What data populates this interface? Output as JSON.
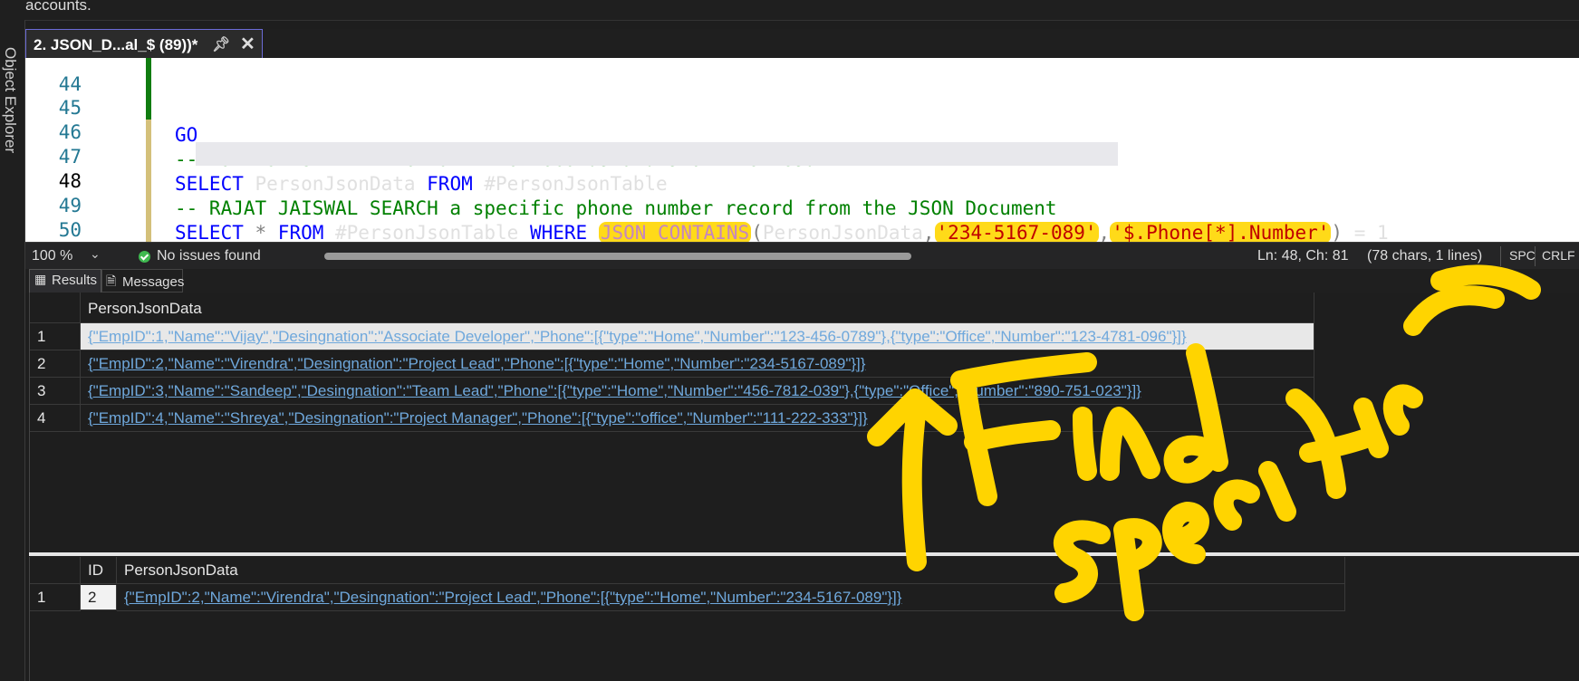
{
  "top_text": "accounts.",
  "side_panel": "Object Explorer",
  "tab": {
    "title": "2. JSON_D...al_$ (89))*",
    "pin_icon": "pin-icon",
    "close_icon": "close-icon"
  },
  "editor": {
    "lines": [
      {
        "num": "44",
        "code": ""
      },
      {
        "num": "45",
        "code": "GO"
      },
      {
        "num": "46",
        "code": "--RAJAT JAISWAL  FETCH all the records and show the result"
      },
      {
        "num": "47",
        "code": "SELECT PersonJsonData FROM #PersonJsonTable"
      },
      {
        "num": "48",
        "code": "-- RAJAT JAISWAL SEARCH a specific phone number record from the JSON Document"
      },
      {
        "num": "49",
        "code": "SELECT * FROM #PersonJsonTable WHERE JSON_CONTAINS(PersonJsonData,'234-5167-089','$.Phone[*].Number') = 1"
      },
      {
        "num": "50",
        "code": ""
      }
    ],
    "current_line": "48",
    "l45_go": "GO",
    "l46": "--RAJAT JAISWAL  FETCH all the records and show the result",
    "l47_kw1": "SELECT",
    "l47_col": " PersonJsonData ",
    "l47_kw2": "FROM",
    "l47_tbl": " #PersonJsonTable",
    "l48": "-- RAJAT JAISWAL SEARCH a specific phone number record from the JSON Document",
    "l49_kw1": "SELECT",
    "l49_star": " * ",
    "l49_kw2": "FROM",
    "l49_tbl": " #PersonJsonTable ",
    "l49_kw3": "WHERE",
    "l49_fn": "JSON_CONTAINS",
    "l49_open": "(",
    "l49_arg": "PersonJsonData",
    "l49_comma1": ",",
    "l49_str1": "'234-5167-089'",
    "l49_comma2": ",",
    "l49_str2": "'$.Phone[*].Number'",
    "l49_close": ")",
    "l49_tail": " = 1"
  },
  "status": {
    "zoom": "100 %",
    "issues": "No issues found",
    "position": "Ln: 48, Ch: 81",
    "chars": "(78 chars, 1 lines)",
    "whitespace": "SPC",
    "line_ending": "CRLF"
  },
  "result_tabs": {
    "results": "Results",
    "messages": "Messages"
  },
  "grid1": {
    "header": "PersonJsonData",
    "rows": [
      {
        "n": "1",
        "v": "{\"EmpID\":1,\"Name\":\"Vijay\",\"Desingnation\":\"Associate Developer\",\"Phone\":[{\"type\":\"Home\",\"Number\":\"123-456-0789\"},{\"type\":\"Office\",\"Number\":\"123-4781-096\"}]}"
      },
      {
        "n": "2",
        "v": "{\"EmpID\":2,\"Name\":\"Virendra\",\"Desingnation\":\"Project Lead\",\"Phone\":[{\"type\":\"Home\",\"Number\":\"234-5167-089\"}]}"
      },
      {
        "n": "3",
        "v": "{\"EmpID\":3,\"Name\":\"Sandeep\",\"Desingnation\":\"Team Lead\",\"Phone\":[{\"type\":\"Home\",\"Number\":\"456-7812-039\"},{\"type\":\"Office\",\"Number\":\"890-751-023\"}]}"
      },
      {
        "n": "4",
        "v": "{\"EmpID\":4,\"Name\":\"Shreya\",\"Desingnation\":\"Project Manager\",\"Phone\":[{\"type\":\"office\",\"Number\":\"111-222-333\"}]}"
      }
    ]
  },
  "grid2": {
    "headers": [
      "ID",
      "PersonJsonData"
    ],
    "rows": [
      {
        "n": "1",
        "id": "2",
        "v": "{\"EmpID\":2,\"Name\":\"Virendra\",\"Desingnation\":\"Project Lead\",\"Phone\":[{\"type\":\"Home\",\"Number\":\"234-5167-089\"}]}"
      }
    ]
  },
  "annotation": {
    "text_line1": "Find",
    "text_line2": "specific data",
    "color": "#ffd400"
  }
}
